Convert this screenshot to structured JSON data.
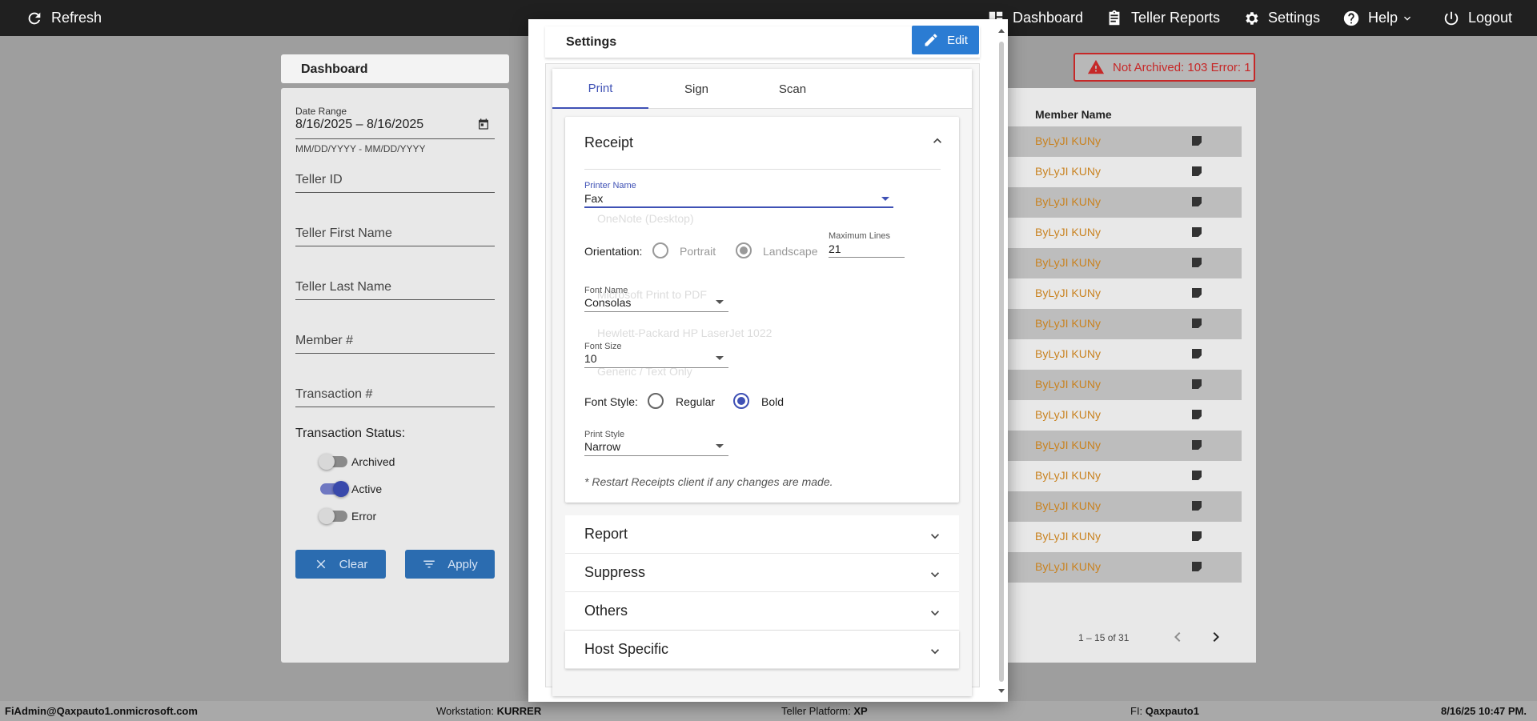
{
  "topbar": {
    "refresh": "Refresh",
    "dashboard": "Dashboard",
    "teller_reports": "Teller Reports",
    "settings": "Settings",
    "help": "Help",
    "logout": "Logout"
  },
  "dashboard": {
    "title": "Dashboard",
    "date_range_label": "Date Range",
    "date_range_value": "8/16/2025 – 8/16/2025",
    "date_range_hint": "MM/DD/YYYY - MM/DD/YYYY",
    "teller_id": "Teller ID",
    "teller_first_name": "Teller First Name",
    "teller_last_name": "Teller Last Name",
    "member_number": "Member #",
    "transaction_number": "Transaction #",
    "transaction_status": "Transaction Status:",
    "status_archived": "Archived",
    "status_active": "Active",
    "status_error": "Error",
    "clear": "Clear",
    "apply": "Apply"
  },
  "alert": {
    "text": "Not Archived: 103  Error: 1"
  },
  "table": {
    "header": "Member Name",
    "rows": [
      "ByLyJI KUNy",
      "ByLyJI KUNy",
      "ByLyJI KUNy",
      "ByLyJI KUNy",
      "ByLyJI KUNy",
      "ByLyJI KUNy",
      "ByLyJI KUNy",
      "ByLyJI KUNy",
      "ByLyJI KUNy",
      "ByLyJI KUNy",
      "ByLyJI KUNy",
      "ByLyJI KUNy",
      "ByLyJI KUNy",
      "ByLyJI KUNy",
      "ByLyJI KUNy"
    ],
    "pager": "1 – 15 of 31"
  },
  "footer": {
    "user": "FiAdmin@Qaxpauto1.onmicrosoft.com",
    "workstation_label": "Workstation: ",
    "workstation": "KURRER",
    "platform_label": "Teller Platform: ",
    "platform": "XP",
    "fi_label": "FI: ",
    "fi": "Qaxpauto1",
    "datetime": "8/16/25 10:47 PM."
  },
  "modal": {
    "title": "Settings",
    "edit": "Edit",
    "tabs": [
      "Print",
      "Sign",
      "Scan"
    ],
    "receipt": {
      "title": "Receipt",
      "printer_name_label": "Printer Name",
      "printer_name": "Fax",
      "printer_options_behind": [
        "OneNote (Desktop)",
        "Microsoft Print to PDF",
        "Hewlett-Packard HP LaserJet 1022",
        "Generic / Text Only"
      ],
      "orientation_label": "Orientation:",
      "portrait": "Portrait",
      "landscape": "Landscape",
      "max_lines_label": "Maximum Lines",
      "max_lines": "21",
      "font_name_label": "Font Name",
      "font_name": "Consolas",
      "font_size_label": "Font Size",
      "font_size": "10",
      "font_style_label": "Font Style:",
      "regular": "Regular",
      "bold": "Bold",
      "print_style_label": "Print Style",
      "print_style": "Narrow",
      "note": "* Restart Receipts client if any changes are made."
    },
    "sections": [
      "Report",
      "Suppress",
      "Others",
      "Host Specific"
    ]
  },
  "colors": {
    "accent": "#3f51b5",
    "primary_button": "#2b7cd3",
    "member_name": "#c9821f",
    "alert": "#c62828"
  }
}
